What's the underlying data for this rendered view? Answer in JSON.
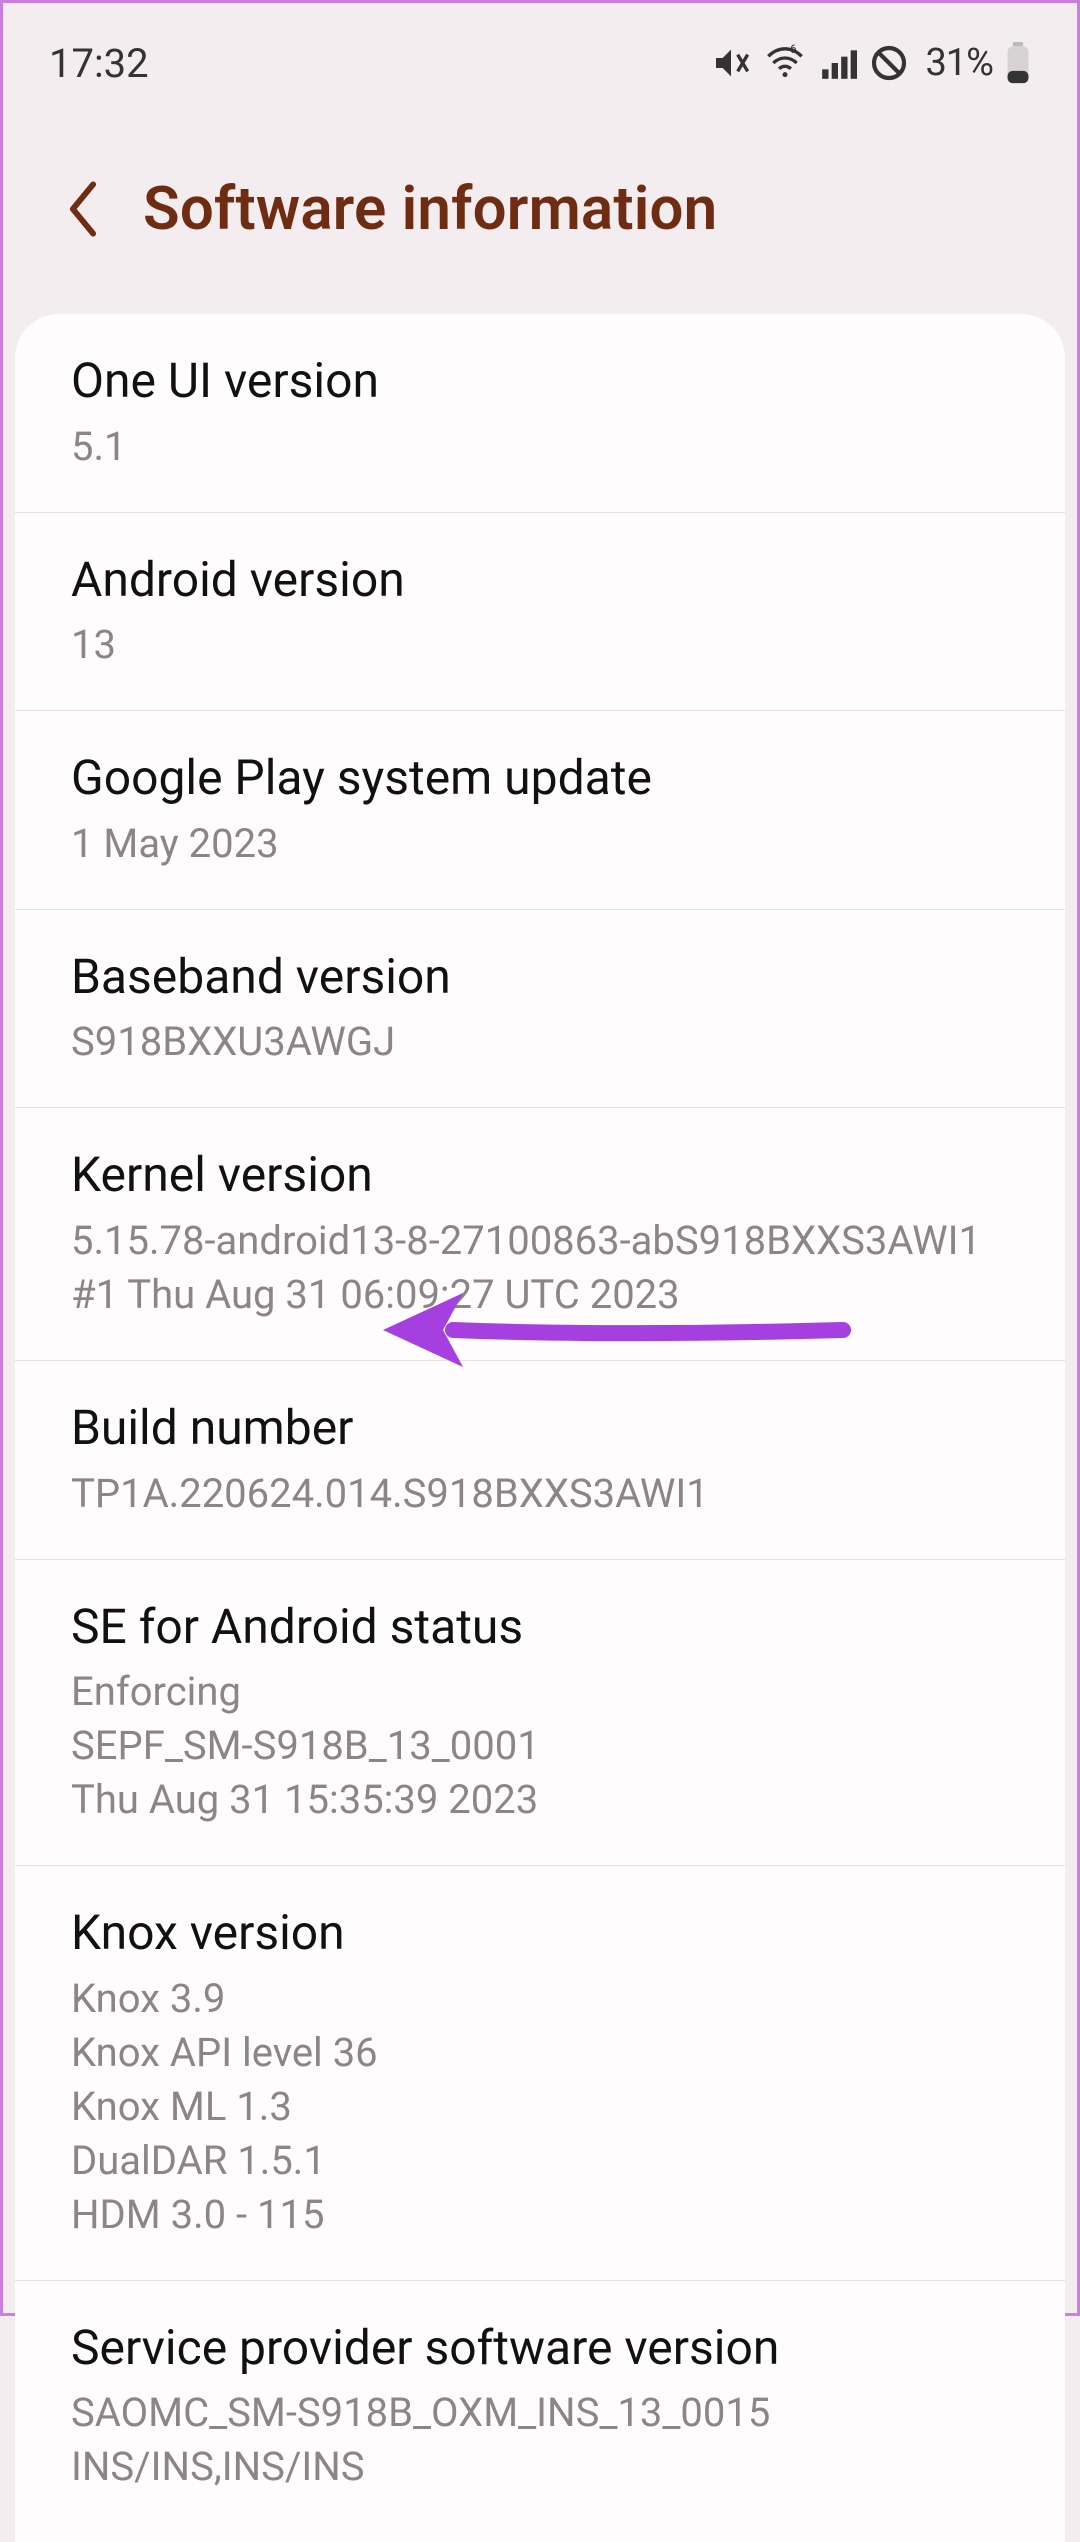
{
  "status": {
    "time": "17:32",
    "battery_text": "31%"
  },
  "header": {
    "title": "Software information"
  },
  "rows": [
    {
      "title": "One UI version",
      "sub": "5.1"
    },
    {
      "title": "Android version",
      "sub": "13"
    },
    {
      "title": "Google Play system update",
      "sub": "1 May 2023"
    },
    {
      "title": "Baseband version",
      "sub": "S918BXXU3AWGJ"
    },
    {
      "title": "Kernel version",
      "sub": "5.15.78-android13-8-27100863-abS918BXXS3AWI1\n#1 Thu Aug 31 06:09:27 UTC 2023"
    },
    {
      "title": "Build number",
      "sub": "TP1A.220624.014.S918BXXS3AWI1"
    },
    {
      "title": "SE for Android status",
      "sub": "Enforcing\nSEPF_SM-S918B_13_0001\nThu Aug 31 15:35:39 2023"
    },
    {
      "title": "Knox version",
      "sub": "Knox 3.9\nKnox API level 36\nKnox ML 1.3\nDualDAR 1.5.1\nHDM 3.0 - 115"
    },
    {
      "title": "Service provider software version",
      "sub": "SAOMC_SM-S918B_OXM_INS_13_0015\nINS/INS,INS/INS"
    }
  ],
  "annotation": {
    "arrow_color": "#a63fe0"
  }
}
